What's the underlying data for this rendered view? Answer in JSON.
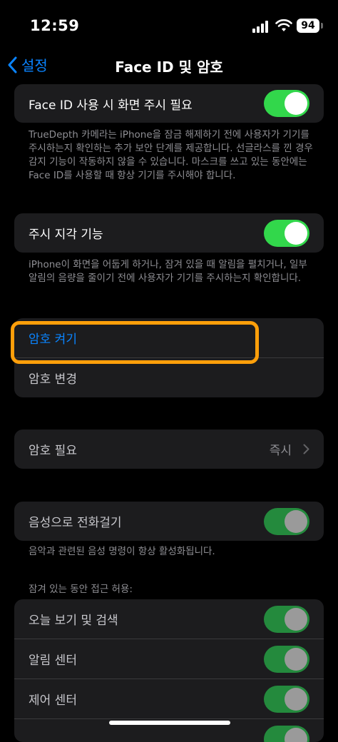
{
  "status": {
    "time": "12:59",
    "battery": "94"
  },
  "nav": {
    "back_label": "설정",
    "title": "Face ID 및 암호"
  },
  "attention": {
    "label": "Face ID 사용 시 화면 주시 필요",
    "footnote": "TrueDepth 카메라는 iPhone을 잠금 해제하기 전에 사용자가 기기를 주시하는지 확인하는 추가 보안 단계를 제공합니다. 선글라스를 낀 경우 감지 기능이 작동하지 않을 수 있습니다. 마스크를 쓰고 있는 동안에는 Face ID를 사용할 때 항상 기기를 주시해야 합니다.",
    "enabled": true
  },
  "aware": {
    "label": "주시 지각 기능",
    "footnote": "iPhone이 화면을 어둡게 하거나, 잠겨 있을 때 알림을 펼치거나, 일부 알림의 음량을 줄이기 전에 사용자가 기기를 주시하는지 확인합니다.",
    "enabled": true
  },
  "passcode": {
    "turn_on": "암호 켜기",
    "change": "암호 변경"
  },
  "require": {
    "label": "암호 필요",
    "value": "즉시"
  },
  "voice_dial": {
    "label": "음성으로 전화걸기",
    "footnote": "음악과 관련된 음성 명령이 항상 활성화됩니다.",
    "enabled": true
  },
  "locked_access": {
    "header": "잠겨 있는 동안 접근 허용:",
    "items": [
      {
        "label": "오늘 보기 및 검색",
        "enabled": true
      },
      {
        "label": "알림 센터",
        "enabled": true
      },
      {
        "label": "제어 센터",
        "enabled": true
      }
    ]
  },
  "colors": {
    "accent": "#0a84ff",
    "toggle_on": "#32d74b",
    "highlight": "#ff9f0a"
  }
}
